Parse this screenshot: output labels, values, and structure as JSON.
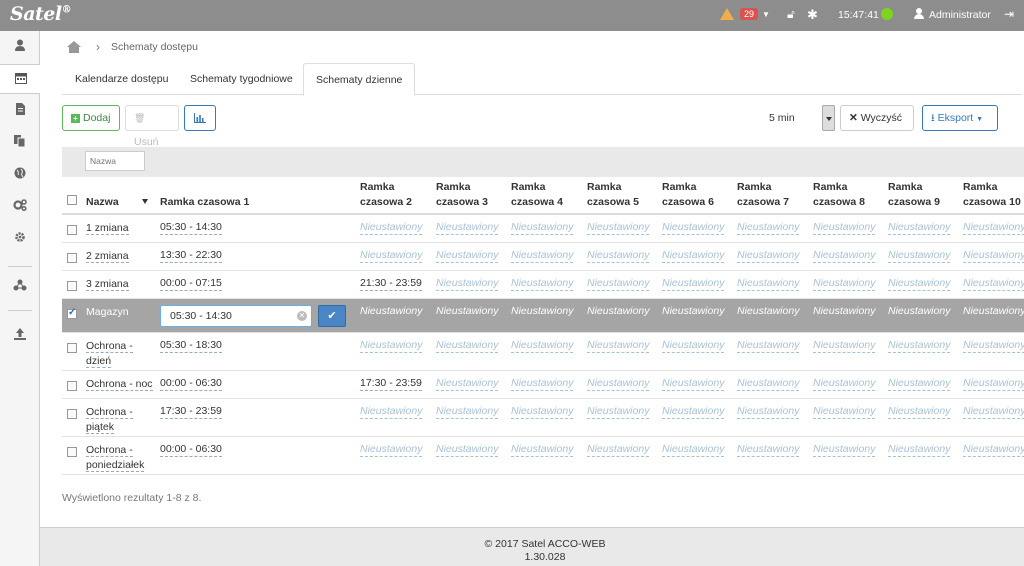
{
  "header": {
    "logo": "Satel",
    "alerts_count": "29",
    "clock": "15:47:41",
    "user": "Administrator",
    "colors": {
      "bar": "#8d8d8d",
      "status_ok": "#7ed321",
      "alert": "#d9534f",
      "warning": "#f0ad4e"
    }
  },
  "sidebar": {
    "icons": [
      "user-icon",
      "calendar-icon",
      "document-icon",
      "copy-icon",
      "globe-icon",
      "cogs-icon",
      "gear-icon",
      "network-icon",
      "upload-icon"
    ]
  },
  "breadcrumb": {
    "current": "Schematy dostępu"
  },
  "tabs": [
    {
      "label": "Kalendarze dostępu"
    },
    {
      "label": "Schematy tygodniowe"
    },
    {
      "label": "Schematy dzienne",
      "active": true
    }
  ],
  "toolbar": {
    "add_label": "Dodaj",
    "delete_label": "Usuń",
    "interval": "5 min",
    "clear_label": "Wyczyść",
    "export_label": "Eksport"
  },
  "filter": {
    "placeholder": "Nazwa"
  },
  "table": {
    "headers": {
      "name": "Nazwa",
      "f1": "Ramka czasowa 1",
      "cols": [
        [
          "Ramka",
          "czasowa 2"
        ],
        [
          "Ramka",
          "czasowa 3"
        ],
        [
          "Ramka",
          "czasowa 4"
        ],
        [
          "Ramka",
          "czasowa 5"
        ],
        [
          "Ramka",
          "czasowa 6"
        ],
        [
          "Ramka",
          "czasowa 7"
        ],
        [
          "Ramka",
          "czasowa 8"
        ],
        [
          "Ramka",
          "czasowa 9"
        ],
        [
          "Ramka",
          "czasowa 10"
        ]
      ]
    },
    "unset_label": "Nieustawiony",
    "rows": [
      {
        "name": [
          "1 zmiana"
        ],
        "f1": "05:30 - 14:30",
        "f2": ""
      },
      {
        "name": [
          "2 zmiana"
        ],
        "f1": "13:30 - 22:30",
        "f2": ""
      },
      {
        "name": [
          "3 zmiana"
        ],
        "f1": "00:00 - 07:15",
        "f2": "21:30 - 23:59"
      },
      {
        "name": [
          "Magazyn"
        ],
        "f1": "05:30 - 14:30",
        "f2": "",
        "selected": true,
        "editing": true
      },
      {
        "name": [
          "Ochrona -",
          "dzień"
        ],
        "f1": "05:30 - 18:30",
        "f2": ""
      },
      {
        "name": [
          "Ochrona - noc"
        ],
        "f1": "00:00 - 06:30",
        "f2": "17:30 - 23:59"
      },
      {
        "name": [
          "Ochrona -",
          "piątek"
        ],
        "f1": "17:30 - 23:59",
        "f2": ""
      },
      {
        "name": [
          "Ochrona -",
          "poniedziałek"
        ],
        "f1": "00:00 - 06:30",
        "f2": ""
      }
    ]
  },
  "results_text": "Wyświetlono rezultaty 1-8 z 8.",
  "footer": {
    "line1": "© 2017 Satel ACCO-WEB",
    "line2": "1.30.028"
  }
}
